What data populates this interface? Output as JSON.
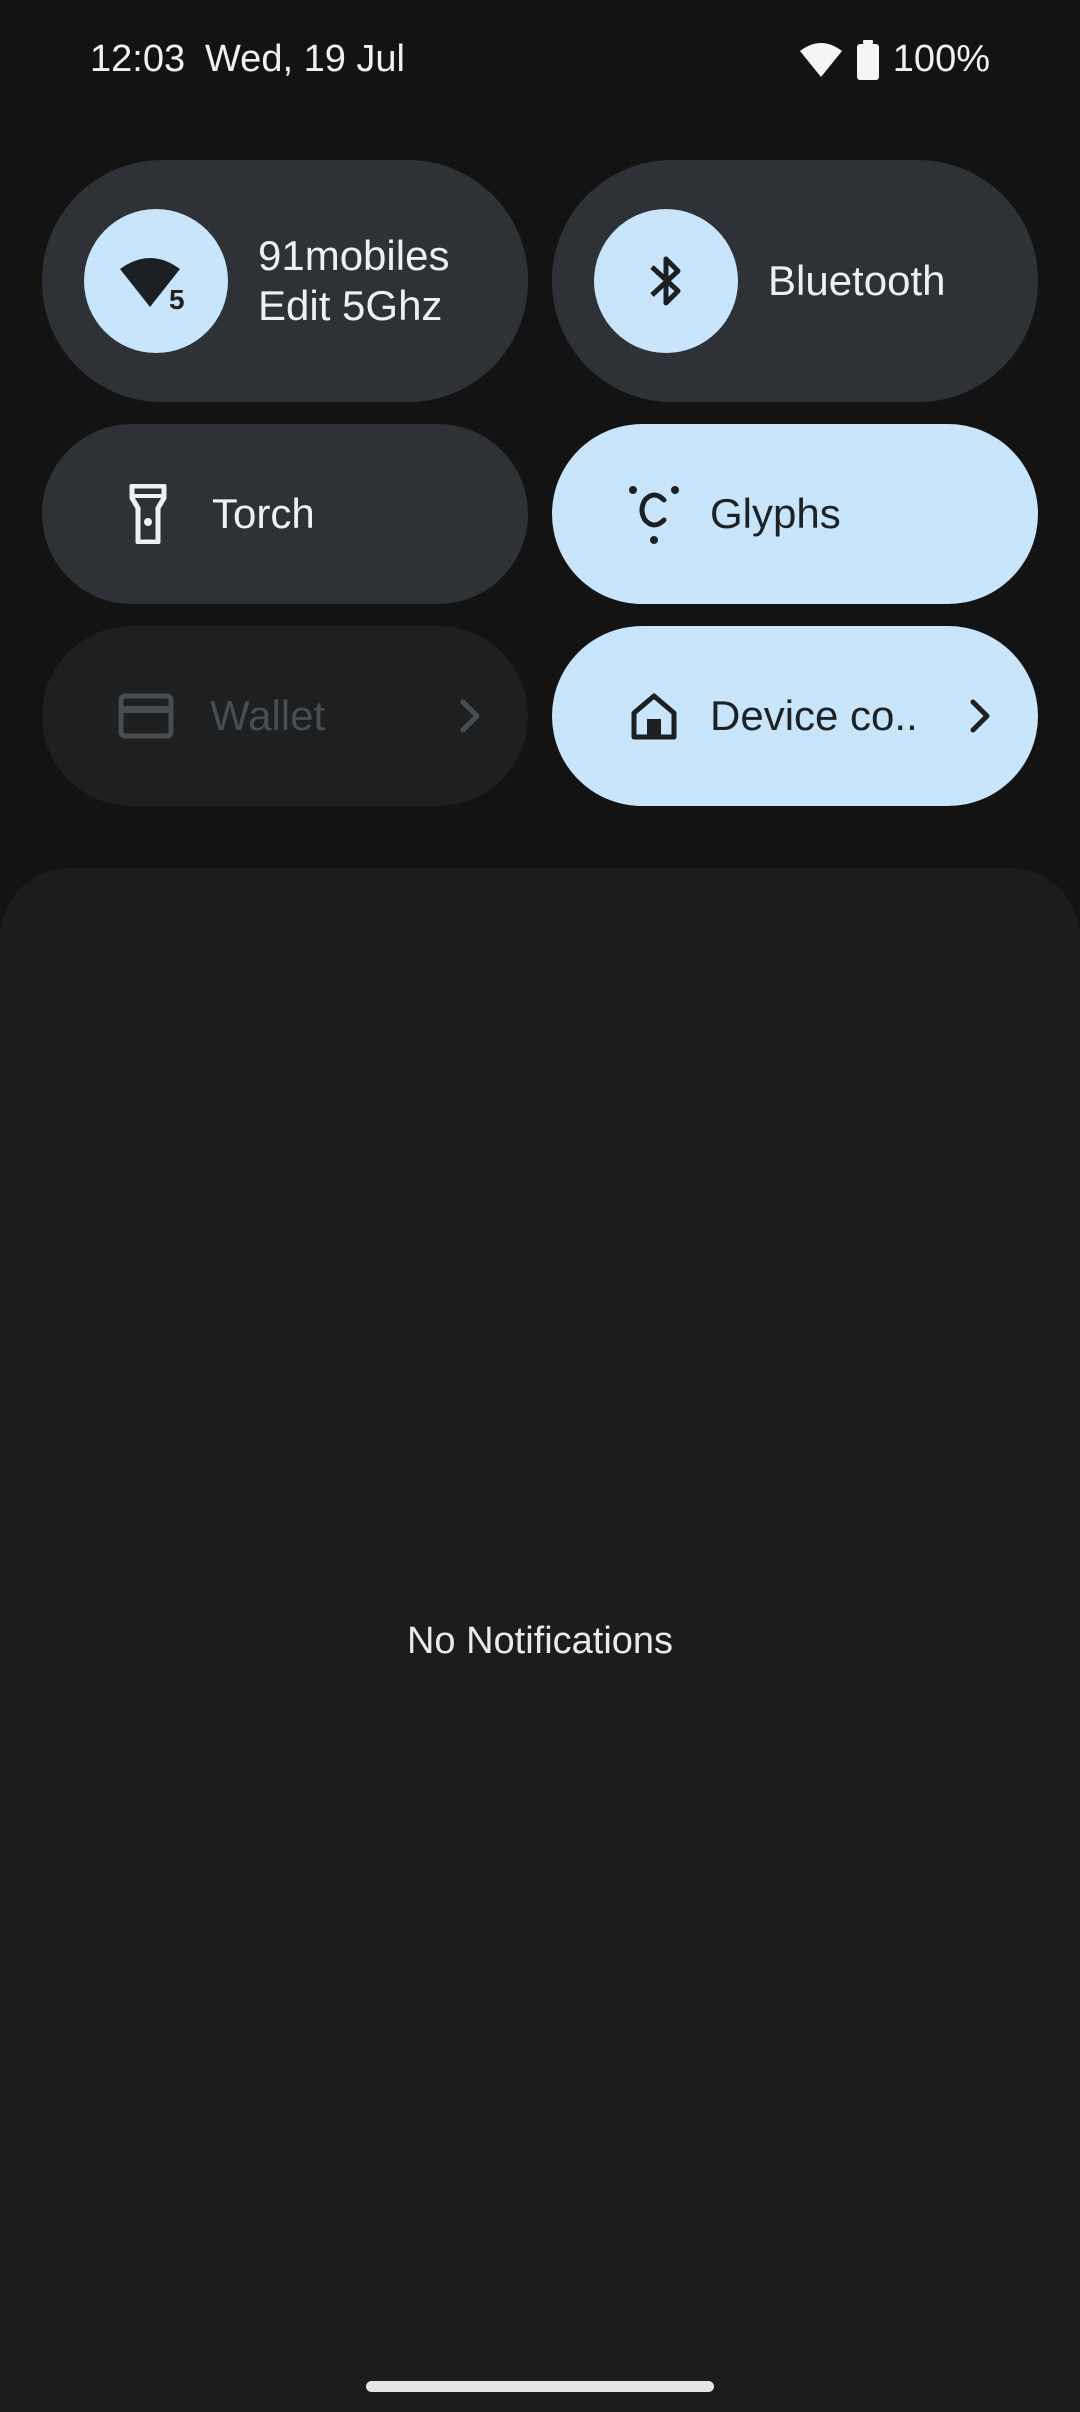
{
  "status_bar": {
    "time": "12:03",
    "date": "Wed, 19 Jul",
    "battery": "100%",
    "icons": [
      "wifi-icon",
      "battery-icon"
    ]
  },
  "tiles": {
    "wifi": {
      "line1": "91mobiles",
      "line2": "Edit 5Ghz",
      "badge": "5",
      "icon": "wifi-icon"
    },
    "bluetooth": {
      "label": "Bluetooth",
      "icon": "bluetooth-icon"
    },
    "torch": {
      "label": "Torch",
      "icon": "flashlight-icon"
    },
    "glyphs": {
      "label": "Glyphs",
      "icon": "glyph-icon"
    },
    "wallet": {
      "label": "Wallet",
      "icon": "card-icon"
    },
    "device_controls": {
      "label": "Device co..",
      "icon": "home-icon"
    }
  },
  "notifications": {
    "empty_text": "No Notifications"
  },
  "colors": {
    "background": "#131313",
    "tile_inactive": "#2e3236",
    "tile_active": "#c8e5fb",
    "panel": "#1a1c1e"
  }
}
